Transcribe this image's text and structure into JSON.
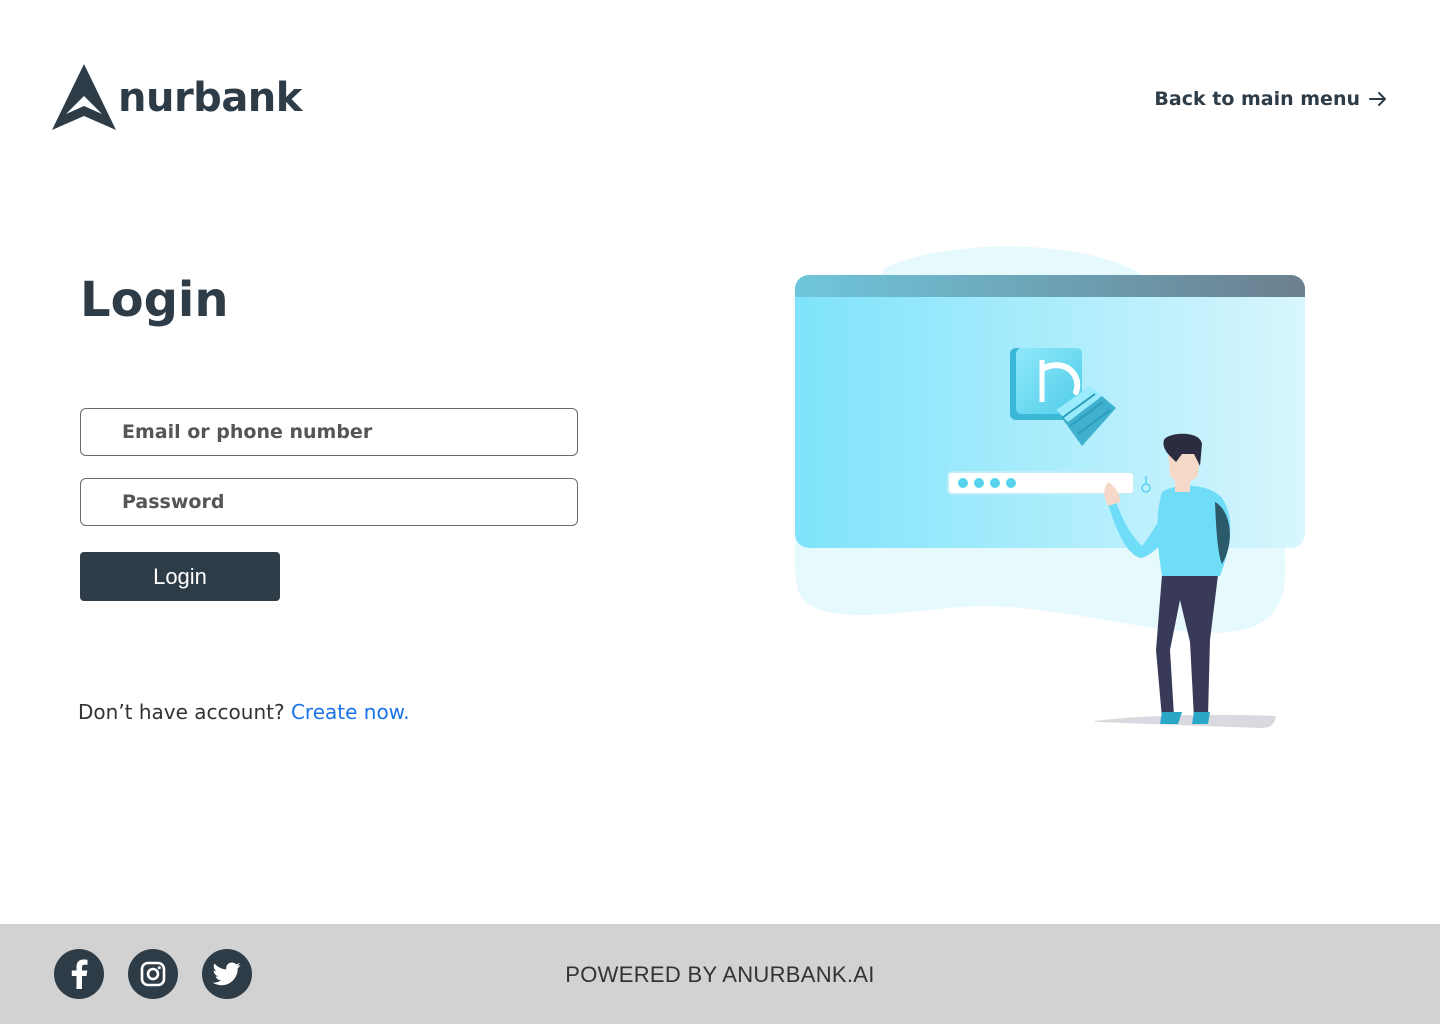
{
  "brand": {
    "logo_icon": "a-arrow-logo-icon",
    "name": "nurbank",
    "color": "#2e3c48"
  },
  "header": {
    "back_label": "Back to main menu",
    "back_icon": "arrow-right-icon"
  },
  "login": {
    "title": "Login",
    "email_placeholder": "Email or phone number",
    "email_value": "",
    "password_placeholder": "Password",
    "password_value": "",
    "submit_label": "Login",
    "signup_prompt": "Don’t have account?",
    "signup_link": "Create now.",
    "link_color": "#1a73e8"
  },
  "illustration": {
    "icon": "secure-login-illustration",
    "accent": "#7ee3fb"
  },
  "footer": {
    "social": [
      {
        "name": "facebook",
        "icon": "facebook-icon"
      },
      {
        "name": "instagram",
        "icon": "instagram-icon"
      },
      {
        "name": "twitter",
        "icon": "twitter-icon"
      }
    ],
    "powered_by": "POWERED BY ANURBANK.AI",
    "background": "#d2d2d2"
  }
}
